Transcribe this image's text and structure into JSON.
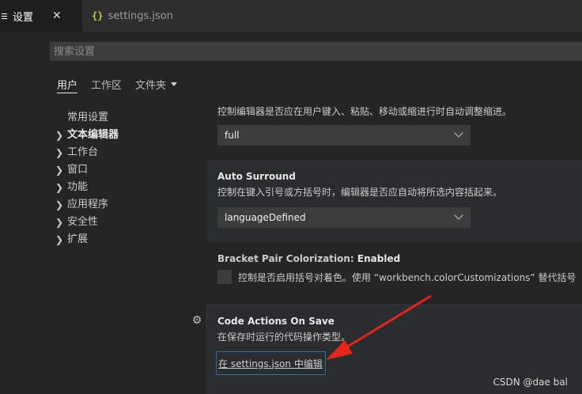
{
  "tabs": [
    {
      "label": "设置",
      "icon": "hamburger-icon",
      "active": true
    },
    {
      "label": "settings.json",
      "icon": "json-braces-icon",
      "icon_glyph": "{}",
      "active": false
    }
  ],
  "search": {
    "placeholder": "搜索设置"
  },
  "scopes": {
    "user": "用户",
    "workspace": "工作区",
    "folder": "文件夹"
  },
  "toc": [
    {
      "label": "常用设置",
      "expandable": false,
      "bold": false
    },
    {
      "label": "文本编辑器",
      "expandable": true,
      "bold": true
    },
    {
      "label": "工作台",
      "expandable": true,
      "bold": false
    },
    {
      "label": "窗口",
      "expandable": true,
      "bold": false
    },
    {
      "label": "功能",
      "expandable": true,
      "bold": false
    },
    {
      "label": "应用程序",
      "expandable": true,
      "bold": false
    },
    {
      "label": "安全性",
      "expandable": true,
      "bold": false
    },
    {
      "label": "扩展",
      "expandable": true,
      "bold": false
    }
  ],
  "settings": {
    "auto_indent": {
      "description": "控制编辑器是否应在用户键入、粘贴、移动或缩进行时自动调整缩进。",
      "value": "full"
    },
    "auto_surround": {
      "title": "Auto Surround",
      "description": "控制在键入引号或方括号时，编辑器是否应自动将所选内容括起来。",
      "value": "languageDefined"
    },
    "bracket_pair": {
      "title_category": "Bracket Pair Colorization: ",
      "title_name": "Enabled",
      "description": "控制是否启用括号对着色。使用 “workbench.colorCustomizations” 替代括号"
    },
    "code_actions": {
      "title": "Code Actions On Save",
      "description": "在保存时运行的代码操作类型。",
      "link": "在 settings.json 中编辑"
    }
  },
  "watermark": "CSDN @dae bal",
  "colors": {
    "background": "#252526",
    "annotation_arrow": "#e8231b",
    "focus_border": "#2e6fa8"
  }
}
